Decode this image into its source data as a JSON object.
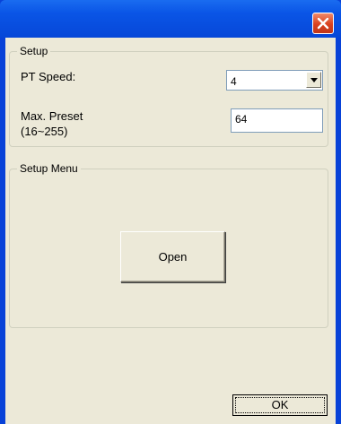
{
  "window": {
    "close_icon": "close-icon"
  },
  "setup": {
    "title": "Setup",
    "pt_speed_label": "PT Speed:",
    "pt_speed_value": "4",
    "max_preset_label_line1": "Max. Preset",
    "max_preset_label_line2": "(16~255)",
    "max_preset_value": "64"
  },
  "setup_menu": {
    "title": "Setup Menu",
    "open_label": "Open"
  },
  "footer": {
    "ok_label": "OK"
  },
  "colors": {
    "titlebar": "#0a55e6",
    "close_button": "#d9411e",
    "dialog_background": "#ece9d8"
  }
}
